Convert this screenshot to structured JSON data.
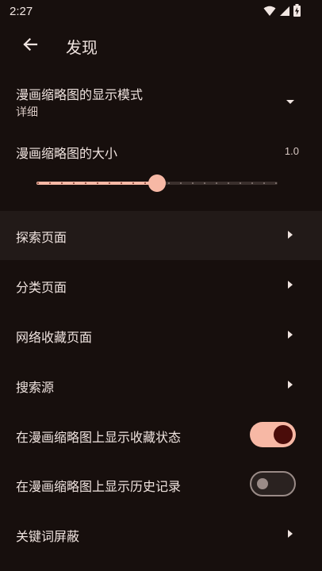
{
  "status_bar": {
    "time": "2:27",
    "icons": [
      "wifi-icon",
      "signal-icon",
      "battery-charging-icon"
    ]
  },
  "app_bar": {
    "back_icon": "arrow-back-icon",
    "title": "发现"
  },
  "settings": {
    "thumbnail_mode": {
      "label": "漫画缩略图的显示模式",
      "value": "详细"
    },
    "thumbnail_size": {
      "label": "漫画缩略图的大小",
      "value": "1.0",
      "slider_fraction": 0.5
    },
    "explore_page": {
      "label": "探索页面"
    },
    "category_page": {
      "label": "分类页面"
    },
    "network_favorites_page": {
      "label": "网络收藏页面"
    },
    "search_source": {
      "label": "搜索源"
    },
    "show_favorite_status": {
      "label": "在漫画缩略图上显示收藏状态",
      "enabled": true
    },
    "show_history": {
      "label": "在漫画缩略图上显示历史记录",
      "enabled": false
    },
    "keyword_block": {
      "label": "关键词屏蔽"
    }
  },
  "colors": {
    "background": "#170f0d",
    "accent": "#f7b8a5",
    "switch_knob_on": "#4a0c0a",
    "text": "#efe3df"
  }
}
